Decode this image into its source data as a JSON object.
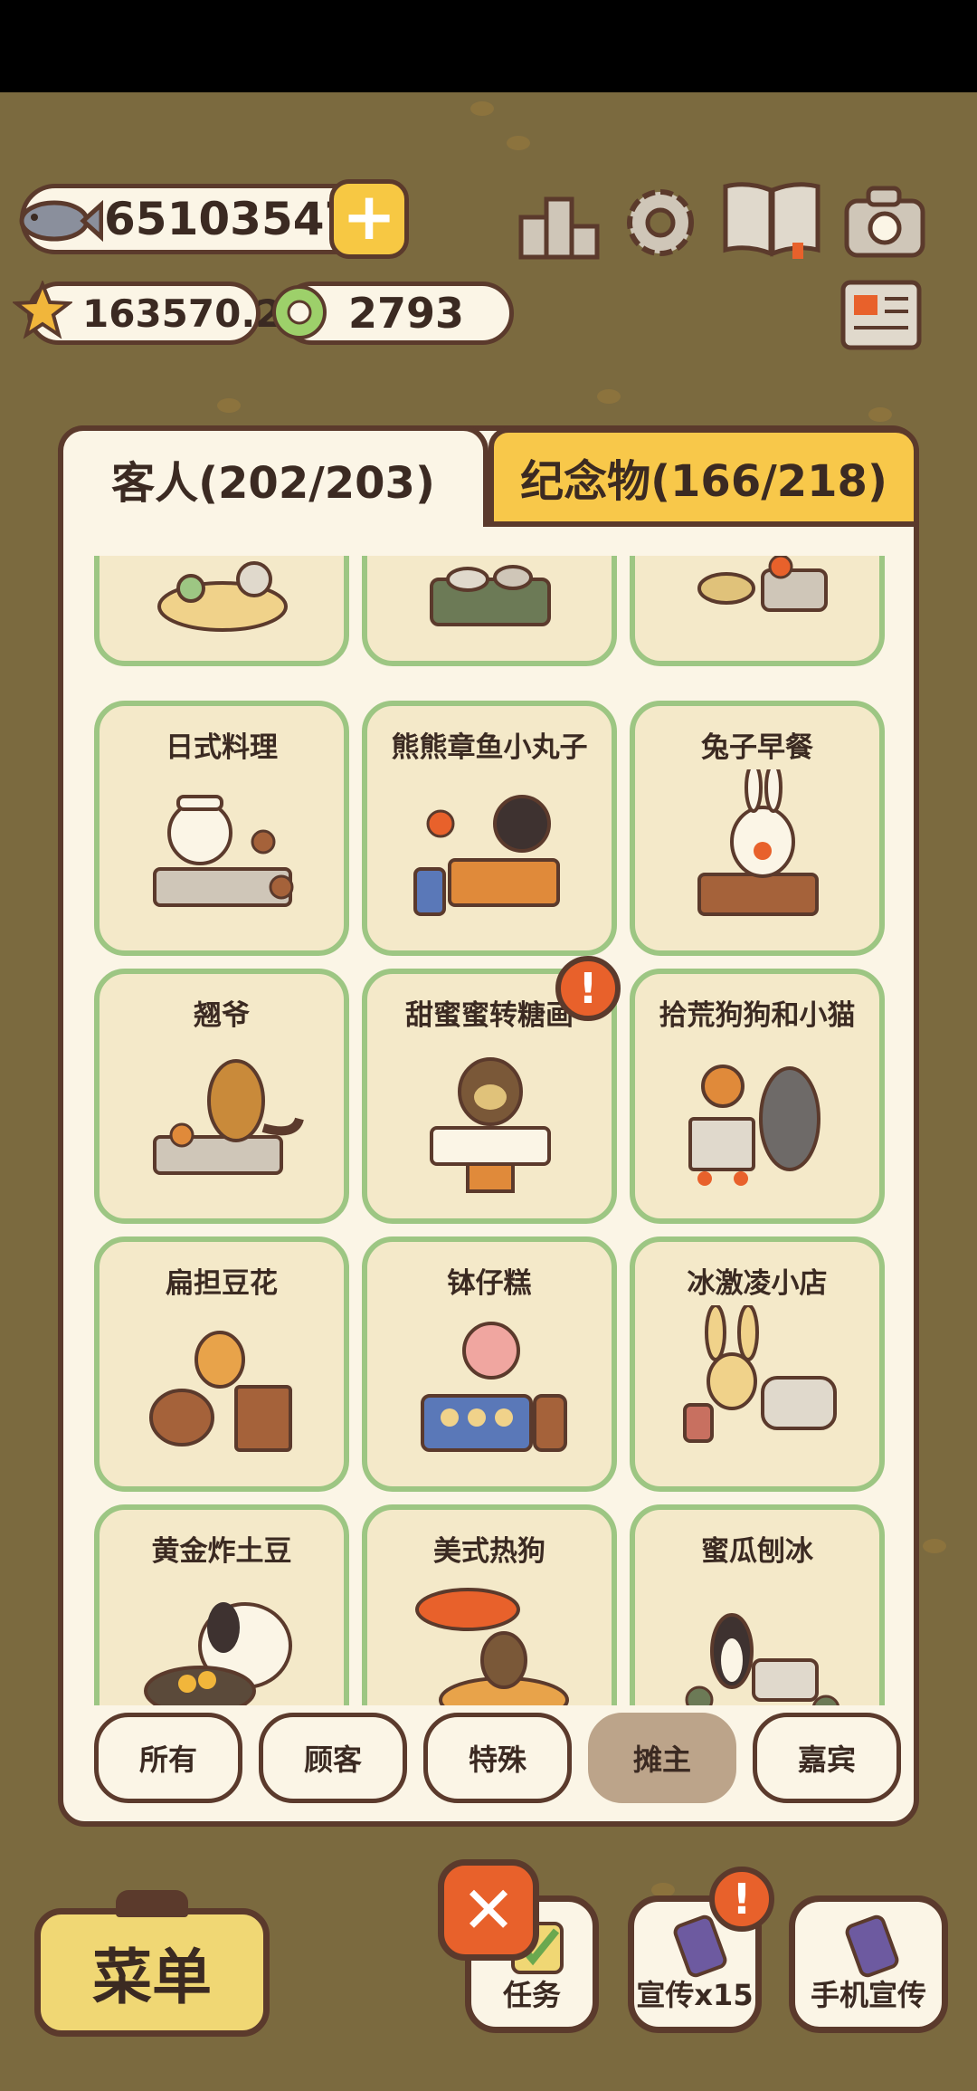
{
  "currency": {
    "fish": "65103547",
    "stars": "163570.2",
    "coins": "2793"
  },
  "tabs": {
    "guests": "客人(202/203)",
    "souvenirs": "纪念物(166/218)"
  },
  "cards": [
    {
      "title": ""
    },
    {
      "title": ""
    },
    {
      "title": ""
    },
    {
      "title": "日式料理"
    },
    {
      "title": "熊熊章鱼小丸子"
    },
    {
      "title": "兔子早餐"
    },
    {
      "title": "翘爷"
    },
    {
      "title": "甜蜜蜜转糖画"
    },
    {
      "title": "拾荒狗狗和小猫"
    },
    {
      "title": "扁担豆花"
    },
    {
      "title": "钵仔糕"
    },
    {
      "title": "冰激凌小店"
    },
    {
      "title": "黄金炸土豆"
    },
    {
      "title": "美式热狗"
    },
    {
      "title": "蜜瓜刨冰"
    }
  ],
  "filters": {
    "all": "所有",
    "customers": "顾客",
    "special": "特殊",
    "stall_owners": "摊主",
    "vip": "嘉宾"
  },
  "bottom": {
    "menu": "菜单",
    "tasks": "任务",
    "promote": "宣传x15",
    "phone_promote": "手机宣传"
  },
  "colors": {
    "border": "#5b3a2c",
    "card_border": "#9dc683",
    "card_bg": "#f4e9c9",
    "accent_yellow": "#f8c84a",
    "alert": "#e8612b",
    "active_filter": "#bca48a"
  }
}
